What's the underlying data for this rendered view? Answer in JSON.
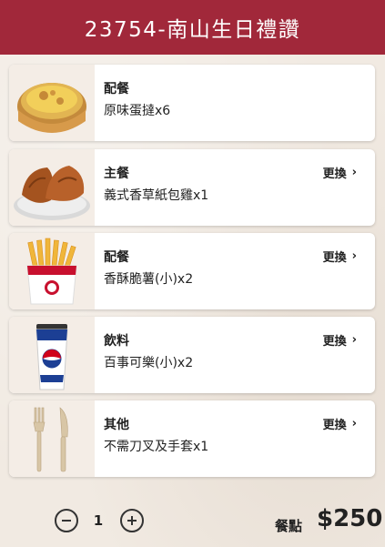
{
  "header": {
    "title": "23754-南山生日禮讚"
  },
  "items": [
    {
      "category": "配餐",
      "description": "原味蛋撻x6",
      "change_label": "",
      "image_icon": "egg-tart-image"
    },
    {
      "category": "主餐",
      "description": "義式香草紙包雞x1",
      "change_label": "更換",
      "image_icon": "fried-chicken-image"
    },
    {
      "category": "配餐",
      "description": "香酥脆薯(小)x2",
      "change_label": "更換",
      "image_icon": "french-fries-image"
    },
    {
      "category": "飲料",
      "description": "百事可樂(小)x2",
      "change_label": "更換",
      "image_icon": "pepsi-cup-image"
    },
    {
      "category": "其他",
      "description": "不需刀叉及手套x1",
      "change_label": "更換",
      "image_icon": "fork-knife-image"
    }
  ],
  "footer": {
    "quantity": "1",
    "points_label": "餐點",
    "price": "$250"
  }
}
